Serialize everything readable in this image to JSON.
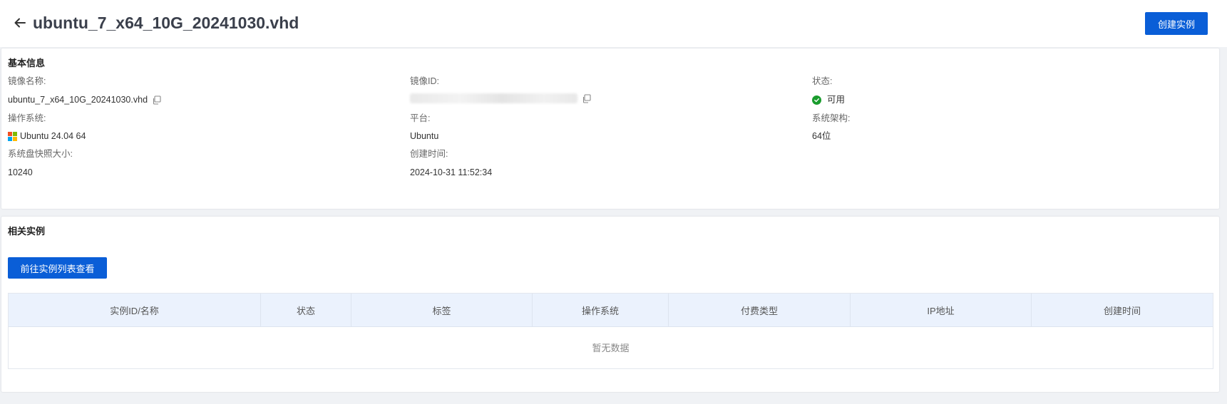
{
  "header": {
    "title": "ubuntu_7_x64_10G_20241030.vhd",
    "create_button": "创建实例"
  },
  "basic_info": {
    "section_title": "基本信息",
    "image_name_label": "镜像名称:",
    "image_name_value": "ubuntu_7_x64_10G_20241030.vhd",
    "image_id_label": "镜像ID:",
    "status_label": "状态:",
    "status_value": "可用",
    "os_label": "操作系统:",
    "os_value": "Ubuntu 24.04 64",
    "platform_label": "平台:",
    "platform_value": "Ubuntu",
    "arch_label": "系统架构:",
    "arch_value": "64位",
    "snapshot_size_label": "系统盘快照大小:",
    "snapshot_size_value": "10240",
    "created_label": "创建时间:",
    "created_value": "2024-10-31 11:52:34"
  },
  "related": {
    "section_title": "相关实例",
    "goto_button": "前往实例列表查看",
    "columns": [
      "实例ID/名称",
      "状态",
      "标签",
      "操作系统",
      "付费类型",
      "IP地址",
      "创建时间"
    ],
    "empty_text": "暂无数据"
  },
  "colors": {
    "primary": "#0a5ed7",
    "status_ok": "#1a9c2d",
    "table_header_bg": "#ebf2fd"
  },
  "icons": {
    "back": "arrow-left-icon",
    "copy": "copy-icon",
    "status": "check-circle-icon",
    "os": "windows-logo-icon"
  }
}
